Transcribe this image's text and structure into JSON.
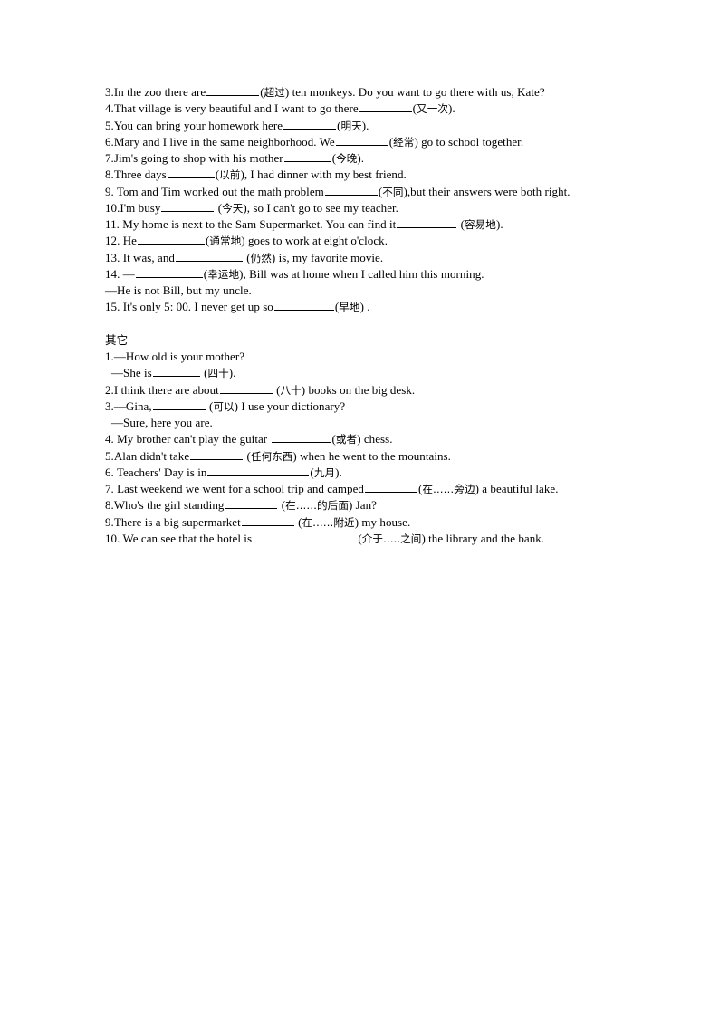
{
  "document": {
    "page_background": "#ffffff",
    "text_color": "#000000",
    "sections": [
      {
        "id": "section-1",
        "heading": null,
        "items": [
          {
            "number": "3.",
            "parts": [
              {
                "t": "text",
                "v": "In the zoo there are"
              },
              {
                "t": "blank",
                "size": "b-m"
              },
              {
                "t": "text",
                "v": "("
              },
              {
                "t": "cn",
                "v": "超过"
              },
              {
                "t": "text",
                "v": ") ten monkeys. Do you want to go there with us, Kate?"
              }
            ]
          },
          {
            "number": "4.",
            "parts": [
              {
                "t": "text",
                "v": "That village is very beautiful and I want to go there"
              },
              {
                "t": "blank",
                "size": "b-m"
              },
              {
                "t": "text",
                "v": "("
              },
              {
                "t": "cn",
                "v": "又一次"
              },
              {
                "t": "text",
                "v": ")."
              }
            ]
          },
          {
            "number": "5.",
            "parts": [
              {
                "t": "text",
                "v": "You can bring your homework here"
              },
              {
                "t": "blank",
                "size": "b-m"
              },
              {
                "t": "text",
                "v": "("
              },
              {
                "t": "cn",
                "v": "明天"
              },
              {
                "t": "text",
                "v": ")."
              }
            ]
          },
          {
            "number": "6.",
            "parts": [
              {
                "t": "text",
                "v": "Mary and I live in the same neighborhood. We"
              },
              {
                "t": "blank",
                "size": "b-m"
              },
              {
                "t": "text",
                "v": "("
              },
              {
                "t": "cn",
                "v": "经常"
              },
              {
                "t": "text",
                "v": ") go to school together."
              }
            ]
          },
          {
            "number": "7.",
            "parts": [
              {
                "t": "text",
                "v": "Jim's going to shop with his mother"
              },
              {
                "t": "blank",
                "size": "b-s"
              },
              {
                "t": "text",
                "v": "("
              },
              {
                "t": "cn",
                "v": "今晚"
              },
              {
                "t": "text",
                "v": ")."
              }
            ]
          },
          {
            "number": "8.",
            "parts": [
              {
                "t": "text",
                "v": "Three days"
              },
              {
                "t": "blank",
                "size": "b-s"
              },
              {
                "t": "text",
                "v": "("
              },
              {
                "t": "cn",
                "v": "以前"
              },
              {
                "t": "text",
                "v": "), I had dinner with my best friend."
              }
            ]
          },
          {
            "number": "9.",
            "parts": [
              {
                "t": "text",
                "v": " Tom and Tim worked out the math problem"
              },
              {
                "t": "blank",
                "size": "b-m"
              },
              {
                "t": "text",
                "v": "("
              },
              {
                "t": "cn",
                "v": "不同"
              },
              {
                "t": "text",
                "v": "),but their answers were both right."
              }
            ]
          },
          {
            "number": "10.",
            "parts": [
              {
                "t": "text",
                "v": "I'm busy"
              },
              {
                "t": "blank",
                "size": "b-m"
              },
              {
                "t": "text",
                "v": " ("
              },
              {
                "t": "cn",
                "v": "今天"
              },
              {
                "t": "text",
                "v": "), so I can't go to see my teacher."
              }
            ]
          },
          {
            "number": "11.",
            "parts": [
              {
                "t": "text",
                "v": " My home is next to the Sam Supermarket. You can find it"
              },
              {
                "t": "blank",
                "size": "b-l"
              },
              {
                "t": "text",
                "v": " ("
              },
              {
                "t": "cn",
                "v": "容易地"
              },
              {
                "t": "text",
                "v": ")."
              }
            ]
          },
          {
            "number": "12.",
            "parts": [
              {
                "t": "text",
                "v": " He"
              },
              {
                "t": "blank",
                "size": "b-xl"
              },
              {
                "t": "text",
                "v": "("
              },
              {
                "t": "cn",
                "v": "通常地"
              },
              {
                "t": "text",
                "v": ") goes to work at eight o'clock."
              }
            ]
          },
          {
            "number": "13.",
            "parts": [
              {
                "t": "text",
                "v": " It was, and"
              },
              {
                "t": "blank",
                "size": "b-xl"
              },
              {
                "t": "text",
                "v": " ("
              },
              {
                "t": "cn",
                "v": "仍然"
              },
              {
                "t": "text",
                "v": ") is, my favorite movie."
              }
            ]
          },
          {
            "number": "14.",
            "parts": [
              {
                "t": "text",
                "v": " —"
              },
              {
                "t": "blank",
                "size": "b-xl"
              },
              {
                "t": "text",
                "v": "("
              },
              {
                "t": "cn",
                "v": "幸运地"
              },
              {
                "t": "text",
                "v": "), Bill was at home when I called him this morning."
              }
            ]
          },
          {
            "number": "",
            "parts": [
              {
                "t": "text",
                "v": "—He is not Bill, but my uncle."
              }
            ]
          },
          {
            "number": "15.",
            "parts": [
              {
                "t": "text",
                "v": " It's only 5: 00. I never get up so"
              },
              {
                "t": "blank",
                "size": "b-l"
              },
              {
                "t": "text",
                "v": "("
              },
              {
                "t": "cn",
                "v": "早地"
              },
              {
                "t": "text",
                "v": ") ."
              }
            ]
          }
        ]
      },
      {
        "id": "section-2",
        "heading": "其它",
        "items": [
          {
            "number": "1.",
            "parts": [
              {
                "t": "text",
                "v": "—How old is your mother?"
              }
            ]
          },
          {
            "number": "",
            "indent": true,
            "parts": [
              {
                "t": "text",
                "v": "—She is"
              },
              {
                "t": "blank",
                "size": "b-s"
              },
              {
                "t": "text",
                "v": " ("
              },
              {
                "t": "cn",
                "v": "四十"
              },
              {
                "t": "text",
                "v": ")."
              }
            ]
          },
          {
            "number": "2.",
            "parts": [
              {
                "t": "text",
                "v": "I think there are about"
              },
              {
                "t": "blank",
                "size": "b-m"
              },
              {
                "t": "text",
                "v": " ("
              },
              {
                "t": "cn",
                "v": "八十"
              },
              {
                "t": "text",
                "v": ") books on the big desk."
              }
            ]
          },
          {
            "number": "3.",
            "parts": [
              {
                "t": "text",
                "v": "—Gina,"
              },
              {
                "t": "blank",
                "size": "b-m"
              },
              {
                "t": "text",
                "v": " ("
              },
              {
                "t": "cn",
                "v": "可以"
              },
              {
                "t": "text",
                "v": ") I use your dictionary?"
              }
            ]
          },
          {
            "number": "",
            "indent": true,
            "parts": [
              {
                "t": "text",
                "v": "—Sure, here you are."
              }
            ]
          },
          {
            "number": "4.",
            "parts": [
              {
                "t": "text",
                "v": " My brother can't play the guitar "
              },
              {
                "t": "blank",
                "size": "b-l"
              },
              {
                "t": "text",
                "v": "("
              },
              {
                "t": "cn",
                "v": "或者"
              },
              {
                "t": "text",
                "v": ") chess."
              }
            ]
          },
          {
            "number": "5.",
            "parts": [
              {
                "t": "text",
                "v": "Alan didn't take"
              },
              {
                "t": "blank",
                "size": "b-m"
              },
              {
                "t": "text",
                "v": " ("
              },
              {
                "t": "cn",
                "v": "任何东西"
              },
              {
                "t": "text",
                "v": ") when he went to the mountains."
              }
            ]
          },
          {
            "number": "6.",
            "parts": [
              {
                "t": "text",
                "v": " Teachers' Day is in"
              },
              {
                "t": "blank",
                "size": "b-xxl"
              },
              {
                "t": "text",
                "v": "("
              },
              {
                "t": "cn",
                "v": "九月"
              },
              {
                "t": "text",
                "v": ")."
              }
            ]
          },
          {
            "number": "7.",
            "parts": [
              {
                "t": "text",
                "v": " Last weekend we went for a school trip and  camped"
              },
              {
                "t": "blank",
                "size": "b-m"
              },
              {
                "t": "text",
                "v": "("
              },
              {
                "t": "cn",
                "v": "在……旁边"
              },
              {
                "t": "text",
                "v": ") a beautiful lake."
              }
            ]
          },
          {
            "number": "8.",
            "parts": [
              {
                "t": "text",
                "v": "Who's the girl standing"
              },
              {
                "t": "blank",
                "size": "b-m"
              },
              {
                "t": "text",
                "v": " ("
              },
              {
                "t": "cn",
                "v": "在……的后面"
              },
              {
                "t": "text",
                "v": ") Jan?"
              }
            ]
          },
          {
            "number": "9.",
            "parts": [
              {
                "t": "text",
                "v": "There is a big supermarket"
              },
              {
                "t": "blank",
                "size": "b-m"
              },
              {
                "t": "text",
                "v": " ("
              },
              {
                "t": "cn",
                "v": "在……附近"
              },
              {
                "t": "text",
                "v": ") my house."
              }
            ]
          },
          {
            "number": "10.",
            "parts": [
              {
                "t": "text",
                "v": " We can see that the hotel is"
              },
              {
                "t": "blank",
                "size": "b-xxl"
              },
              {
                "t": "text",
                "v": " ("
              },
              {
                "t": "cn",
                "v": "介于…..之间"
              },
              {
                "t": "text",
                "v": ") the library and the bank."
              }
            ]
          }
        ]
      }
    ]
  }
}
